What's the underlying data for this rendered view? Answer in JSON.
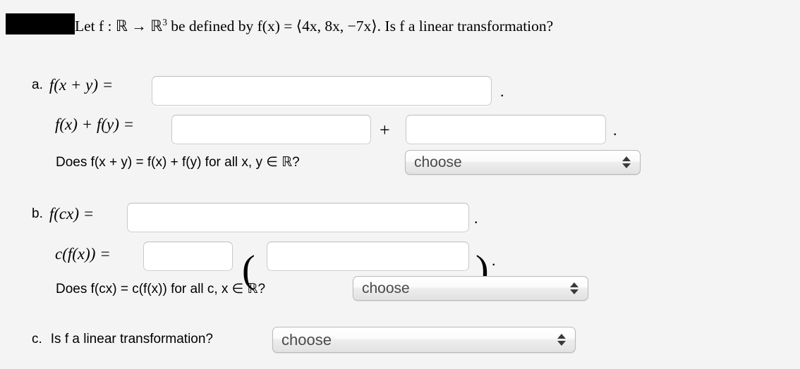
{
  "prompt": {
    "redaction": "",
    "before_sup": "Let f : ℝ → ℝ",
    "superscript": "3",
    "after_sup": " be defined by f(x) = ⟨4x, 8x, −7x⟩. Is f a linear transformation?"
  },
  "items": {
    "a": {
      "letter": "a.",
      "line1_label": "f(x + y) =",
      "line1_period": ".",
      "line1_input_value": "",
      "line1_input_placeholder": "",
      "line2_label": "f(x) + f(y) =",
      "line2_plus": "+",
      "line2_period": ".",
      "line2_input1_value": "",
      "line2_input2_value": "",
      "question": "Does f(x + y) = f(x) + f(y) for all x, y ∈ ℝ?",
      "select_value": "choose"
    },
    "b": {
      "letter": "b.",
      "line1_label": "f(cx) =",
      "line1_period": ".",
      "line1_input_value": "",
      "line2_label": "c(f(x)) =",
      "line2_open_paren": "(",
      "line2_close_paren": ")",
      "line2_period": ".",
      "line2_input1_value": "",
      "line2_input2_value": "",
      "question": "Does f(cx) = c(f(x)) for all c, x ∈ ℝ?",
      "select_value": "choose"
    },
    "c": {
      "letter": "c.",
      "question": "Is f a linear transformation?",
      "select_value": "choose"
    }
  },
  "colors": {
    "page_background": "#f4f4f4",
    "input_background": "#ffffff",
    "input_border": "#c9c9c9",
    "select_text": "#4a4a4a",
    "redaction": "#000000"
  }
}
